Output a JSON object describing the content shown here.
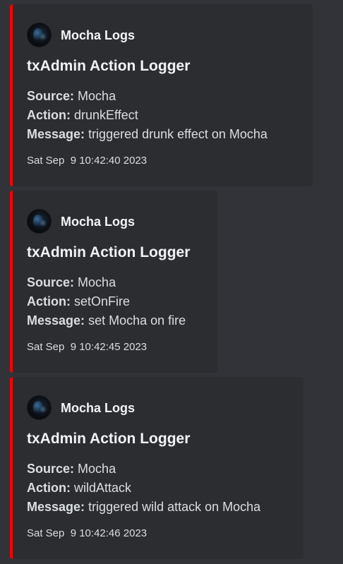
{
  "accent_color": "#ff0000",
  "avatar_icon": "avatar-icon",
  "messages": [
    {
      "author": "Mocha Logs",
      "title": "txAdmin Action Logger",
      "fields": [
        {
          "label": "Source:",
          "value": "Mocha"
        },
        {
          "label": "Action:",
          "value": "drunkEffect"
        },
        {
          "label": "Message:",
          "value": "triggered drunk effect on Mocha"
        }
      ],
      "timestamp": "Sat Sep  9 10:42:40 2023"
    },
    {
      "author": "Mocha Logs",
      "title": "txAdmin Action Logger",
      "fields": [
        {
          "label": "Source:",
          "value": "Mocha"
        },
        {
          "label": "Action:",
          "value": "setOnFire"
        },
        {
          "label": "Message:",
          "value": "set Mocha on fire"
        }
      ],
      "timestamp": "Sat Sep  9 10:42:45 2023"
    },
    {
      "author": "Mocha Logs",
      "title": "txAdmin Action Logger",
      "fields": [
        {
          "label": "Source:",
          "value": "Mocha"
        },
        {
          "label": "Action:",
          "value": "wildAttack"
        },
        {
          "label": "Message:",
          "value": "triggered wild attack on Mocha"
        }
      ],
      "timestamp": "Sat Sep  9 10:42:46 2023"
    }
  ]
}
